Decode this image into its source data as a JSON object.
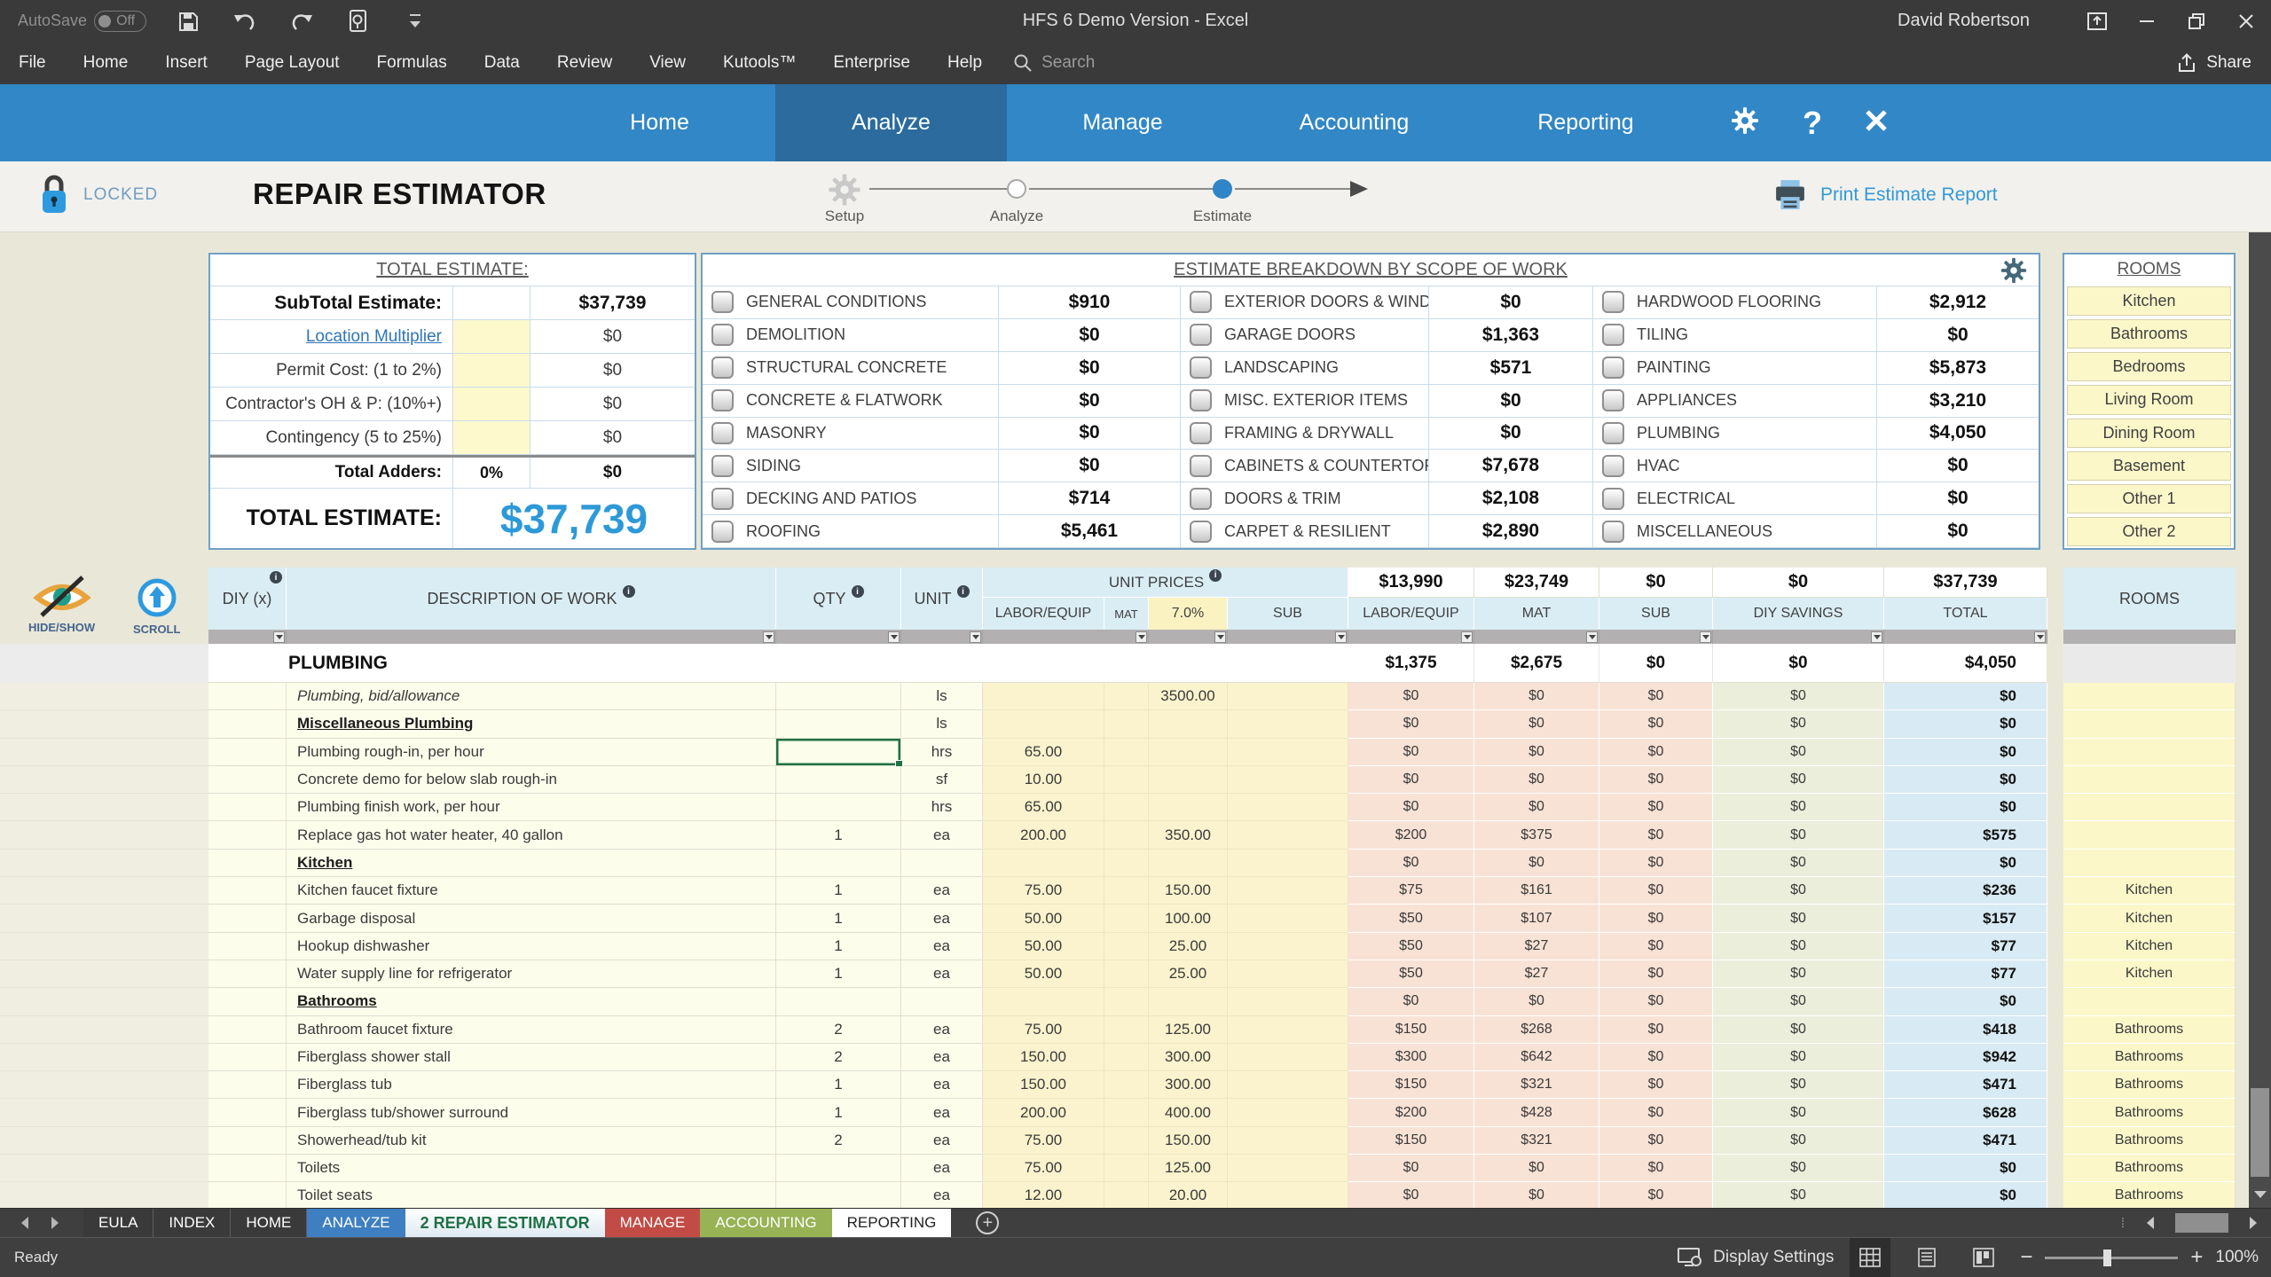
{
  "title_bar": {
    "autosave_label": "AutoSave",
    "autosave_state": "Off",
    "title": "HFS 6 Demo Version  -  Excel",
    "user": "David Robertson"
  },
  "menu_bar": {
    "items": [
      "File",
      "Home",
      "Insert",
      "Page Layout",
      "Formulas",
      "Data",
      "Review",
      "View",
      "Kutools™",
      "Enterprise",
      "Help"
    ],
    "search_placeholder": "Search",
    "share_label": "Share"
  },
  "nav_bar": {
    "tabs": [
      {
        "label": "Home",
        "cls": ""
      },
      {
        "label": "Analyze",
        "cls": "active"
      },
      {
        "label": "Manage",
        "cls": ""
      },
      {
        "label": "Accounting",
        "cls": ""
      },
      {
        "label": "Reporting",
        "cls": ""
      }
    ],
    "help_label": "?"
  },
  "header": {
    "locked_label": "LOCKED",
    "page_title": "REPAIR ESTIMATOR",
    "steps": [
      "Setup",
      "Analyze",
      "Estimate"
    ],
    "print_label": "Print Estimate Report"
  },
  "summary": {
    "title": "TOTAL ESTIMATE:",
    "subtotal_label": "SubTotal Estimate:",
    "subtotal_value": "$37,739",
    "adders": [
      {
        "label": "Location Multiplier",
        "cls": "link",
        "value": "$0"
      },
      {
        "label": "Permit Cost: (1 to 2%)",
        "cls": "",
        "value": "$0"
      },
      {
        "label": "Contractor's  OH & P: (10%+)",
        "cls": "",
        "value": "$0"
      },
      {
        "label": "Contingency (5 to 25%)",
        "cls": "",
        "value": "$0"
      }
    ],
    "total_adders_label": "Total Adders:",
    "total_adders_pct": "0%",
    "total_adders_value": "$0",
    "total_label": "TOTAL ESTIMATE:",
    "total_value": "$37,739"
  },
  "breakdown": {
    "title": "ESTIMATE BREAKDOWN BY SCOPE OF WORK",
    "col1": [
      {
        "label": "GENERAL CONDITIONS",
        "value": "$910"
      },
      {
        "label": "DEMOLITION",
        "value": "$0"
      },
      {
        "label": "STRUCTURAL CONCRETE",
        "value": "$0"
      },
      {
        "label": "CONCRETE & FLATWORK",
        "value": "$0"
      },
      {
        "label": "MASONRY",
        "value": "$0"
      },
      {
        "label": "SIDING",
        "value": "$0"
      },
      {
        "label": "DECKING AND PATIOS",
        "value": "$714"
      },
      {
        "label": "ROOFING",
        "value": "$5,461"
      }
    ],
    "col2": [
      {
        "label": "EXTERIOR DOORS & WINDOWS",
        "value": "$0"
      },
      {
        "label": "GARAGE DOORS",
        "value": "$1,363"
      },
      {
        "label": "LANDSCAPING",
        "value": "$571"
      },
      {
        "label": "MISC. EXTERIOR ITEMS",
        "value": "$0"
      },
      {
        "label": "FRAMING & DRYWALL",
        "value": "$0"
      },
      {
        "label": "CABINETS & COUNTERTOPS",
        "value": "$7,678"
      },
      {
        "label": "DOORS & TRIM",
        "value": "$2,108"
      },
      {
        "label": "CARPET & RESILIENT",
        "value": "$2,890"
      }
    ],
    "col3": [
      {
        "label": "HARDWOOD FLOORING",
        "value": "$2,912"
      },
      {
        "label": "TILING",
        "value": "$0"
      },
      {
        "label": "PAINTING",
        "value": "$5,873"
      },
      {
        "label": "APPLIANCES",
        "value": "$3,210"
      },
      {
        "label": "PLUMBING",
        "value": "$4,050"
      },
      {
        "label": "HVAC",
        "value": "$0"
      },
      {
        "label": "ELECTRICAL",
        "value": "$0"
      },
      {
        "label": "MISCELLANEOUS",
        "value": "$0"
      }
    ]
  },
  "rooms_panel": {
    "title": "ROOMS",
    "rooms": [
      "Kitchen",
      "Bathrooms",
      "Bedrooms",
      "Living Room",
      "Dining Room",
      "Basement",
      "Other 1",
      "Other 2"
    ]
  },
  "grid": {
    "tools": {
      "hide_show": "HIDE/SHOW",
      "scroll": "SCROLL"
    },
    "headers": {
      "diy": "DIY (x)",
      "desc": "DESCRIPTION OF WORK",
      "qty": "QTY",
      "unit": "UNIT",
      "unit_prices": "UNIT PRICES",
      "labor": "LABOR/EQUIP",
      "mat": "MAT",
      "tax": "7.0%",
      "sub": "SUB",
      "diy_savings": "DIY SAVINGS",
      "total": "TOTAL",
      "rooms": "ROOMS"
    },
    "totals": {
      "labor": "$13,990",
      "mat": "$23,749",
      "sub": "$0",
      "diy": "$0",
      "total": "$37,739"
    },
    "section_total": {
      "name": "PLUMBING",
      "labor": "$1,375",
      "mat": "$2,675",
      "sub": "$0",
      "diy": "$0",
      "total": "$4,050"
    },
    "rows": [
      {
        "style": "italic",
        "sel": "",
        "desc": "Plumbing, bid/allowance",
        "qty": "",
        "unit": "ls",
        "labor_unit": "",
        "mat_unit": "3500.00",
        "labor": "$0",
        "mat": "$0",
        "sub": "$0",
        "diy": "$0",
        "total": "$0",
        "room": ""
      },
      {
        "style": "section",
        "sel": "",
        "desc": "Miscellaneous Plumbing",
        "qty": "",
        "unit": "ls",
        "labor_unit": "",
        "mat_unit": "",
        "labor": "$0",
        "mat": "$0",
        "sub": "$0",
        "diy": "$0",
        "total": "$0",
        "room": ""
      },
      {
        "style": "",
        "sel": "selected",
        "desc": "Plumbing rough-in, per hour",
        "qty": "",
        "unit": "hrs",
        "labor_unit": "65.00",
        "mat_unit": "",
        "labor": "$0",
        "mat": "$0",
        "sub": "$0",
        "diy": "$0",
        "total": "$0",
        "room": ""
      },
      {
        "style": "",
        "sel": "",
        "desc": "Concrete demo for below slab rough-in",
        "qty": "",
        "unit": "sf",
        "labor_unit": "10.00",
        "mat_unit": "",
        "labor": "$0",
        "mat": "$0",
        "sub": "$0",
        "diy": "$0",
        "total": "$0",
        "room": ""
      },
      {
        "style": "",
        "sel": "",
        "desc": "Plumbing finish work, per hour",
        "qty": "",
        "unit": "hrs",
        "labor_unit": "65.00",
        "mat_unit": "",
        "labor": "$0",
        "mat": "$0",
        "sub": "$0",
        "diy": "$0",
        "total": "$0",
        "room": ""
      },
      {
        "style": "",
        "sel": "",
        "desc": "Replace gas hot water heater, 40 gallon",
        "qty": "1",
        "unit": "ea",
        "labor_unit": "200.00",
        "mat_unit": "350.00",
        "labor": "$200",
        "mat": "$375",
        "sub": "$0",
        "diy": "$0",
        "total": "$575",
        "room": ""
      },
      {
        "style": "section",
        "sel": "",
        "desc": "Kitchen",
        "qty": "",
        "unit": "",
        "labor_unit": "",
        "mat_unit": "",
        "labor": "$0",
        "mat": "$0",
        "sub": "$0",
        "diy": "$0",
        "total": "$0",
        "room": ""
      },
      {
        "style": "",
        "sel": "",
        "desc": "Kitchen faucet fixture",
        "qty": "1",
        "unit": "ea",
        "labor_unit": "75.00",
        "mat_unit": "150.00",
        "labor": "$75",
        "mat": "$161",
        "sub": "$0",
        "diy": "$0",
        "total": "$236",
        "room": "Kitchen"
      },
      {
        "style": "",
        "sel": "",
        "desc": "Garbage disposal",
        "qty": "1",
        "unit": "ea",
        "labor_unit": "50.00",
        "mat_unit": "100.00",
        "labor": "$50",
        "mat": "$107",
        "sub": "$0",
        "diy": "$0",
        "total": "$157",
        "room": "Kitchen"
      },
      {
        "style": "",
        "sel": "",
        "desc": "Hookup dishwasher",
        "qty": "1",
        "unit": "ea",
        "labor_unit": "50.00",
        "mat_unit": "25.00",
        "labor": "$50",
        "mat": "$27",
        "sub": "$0",
        "diy": "$0",
        "total": "$77",
        "room": "Kitchen"
      },
      {
        "style": "",
        "sel": "",
        "desc": "Water supply line for refrigerator",
        "qty": "1",
        "unit": "ea",
        "labor_unit": "50.00",
        "mat_unit": "25.00",
        "labor": "$50",
        "mat": "$27",
        "sub": "$0",
        "diy": "$0",
        "total": "$77",
        "room": "Kitchen"
      },
      {
        "style": "section",
        "sel": "",
        "desc": "Bathrooms",
        "qty": "",
        "unit": "",
        "labor_unit": "",
        "mat_unit": "",
        "labor": "$0",
        "mat": "$0",
        "sub": "$0",
        "diy": "$0",
        "total": "$0",
        "room": ""
      },
      {
        "style": "",
        "sel": "",
        "desc": "Bathroom faucet fixture",
        "qty": "2",
        "unit": "ea",
        "labor_unit": "75.00",
        "mat_unit": "125.00",
        "labor": "$150",
        "mat": "$268",
        "sub": "$0",
        "diy": "$0",
        "total": "$418",
        "room": "Bathrooms"
      },
      {
        "style": "",
        "sel": "",
        "desc": "Fiberglass shower stall",
        "qty": "2",
        "unit": "ea",
        "labor_unit": "150.00",
        "mat_unit": "300.00",
        "labor": "$300",
        "mat": "$642",
        "sub": "$0",
        "diy": "$0",
        "total": "$942",
        "room": "Bathrooms"
      },
      {
        "style": "",
        "sel": "",
        "desc": "Fiberglass tub",
        "qty": "1",
        "unit": "ea",
        "labor_unit": "150.00",
        "mat_unit": "300.00",
        "labor": "$150",
        "mat": "$321",
        "sub": "$0",
        "diy": "$0",
        "total": "$471",
        "room": "Bathrooms"
      },
      {
        "style": "",
        "sel": "",
        "desc": "Fiberglass tub/shower surround",
        "qty": "1",
        "unit": "ea",
        "labor_unit": "200.00",
        "mat_unit": "400.00",
        "labor": "$200",
        "mat": "$428",
        "sub": "$0",
        "diy": "$0",
        "total": "$628",
        "room": "Bathrooms"
      },
      {
        "style": "",
        "sel": "",
        "desc": "Showerhead/tub kit",
        "qty": "2",
        "unit": "ea",
        "labor_unit": "75.00",
        "mat_unit": "150.00",
        "labor": "$150",
        "mat": "$321",
        "sub": "$0",
        "diy": "$0",
        "total": "$471",
        "room": "Bathrooms"
      },
      {
        "style": "",
        "sel": "",
        "desc": "Toilets",
        "qty": "",
        "unit": "ea",
        "labor_unit": "75.00",
        "mat_unit": "125.00",
        "labor": "$0",
        "mat": "$0",
        "sub": "$0",
        "diy": "$0",
        "total": "$0",
        "room": "Bathrooms"
      },
      {
        "style": "",
        "sel": "",
        "desc": "Toilet seats",
        "qty": "",
        "unit": "ea",
        "labor_unit": "12.00",
        "mat_unit": "20.00",
        "labor": "$0",
        "mat": "$0",
        "sub": "$0",
        "diy": "$0",
        "total": "$0",
        "room": "Bathrooms"
      }
    ]
  },
  "sheet_tabs": {
    "tabs": [
      {
        "label": "EULA",
        "cls": "t-dark"
      },
      {
        "label": "INDEX",
        "cls": "t-dark"
      },
      {
        "label": "HOME",
        "cls": "t-dark"
      },
      {
        "label": "ANALYZE",
        "cls": "t-blue"
      },
      {
        "label": "2 REPAIR ESTIMATOR",
        "cls": "t-active"
      },
      {
        "label": "MANAGE",
        "cls": "t-red"
      },
      {
        "label": "ACCOUNTING",
        "cls": "t-green"
      },
      {
        "label": "REPORTING",
        "cls": "t-white"
      }
    ],
    "add_label": "+"
  },
  "status_bar": {
    "status": "Ready",
    "display_settings_label": "Display Settings",
    "zoom_level": "100%"
  }
}
